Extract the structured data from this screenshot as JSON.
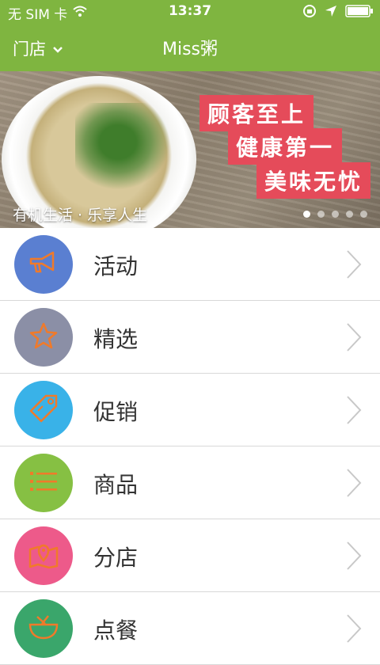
{
  "status_bar": {
    "carrier": "无 SIM 卡",
    "time": "13:37"
  },
  "nav": {
    "store_label": "门店",
    "title": "Miss粥"
  },
  "banner": {
    "slogans": [
      "顾客至上",
      "健康第一",
      "美味无忧"
    ],
    "caption": "有机生活 · 乐享人生",
    "page_count": 5,
    "active_page": 1
  },
  "menu": [
    {
      "label": "活动",
      "icon": "megaphone-icon",
      "color": "#5a7fd1"
    },
    {
      "label": "精选",
      "icon": "star-icon",
      "color": "#8b8fa6"
    },
    {
      "label": "促销",
      "icon": "tag-icon",
      "color": "#39b2e8"
    },
    {
      "label": "商品",
      "icon": "list-icon",
      "color": "#86c043"
    },
    {
      "label": "分店",
      "icon": "map-pin-icon",
      "color": "#ed5a8a"
    },
    {
      "label": "点餐",
      "icon": "bowl-icon",
      "color": "#3aa66b"
    }
  ],
  "colors": {
    "nav_green": "#7fb540",
    "icon_orange": "#f07a2a",
    "slogan_red": "#e54b5a"
  }
}
